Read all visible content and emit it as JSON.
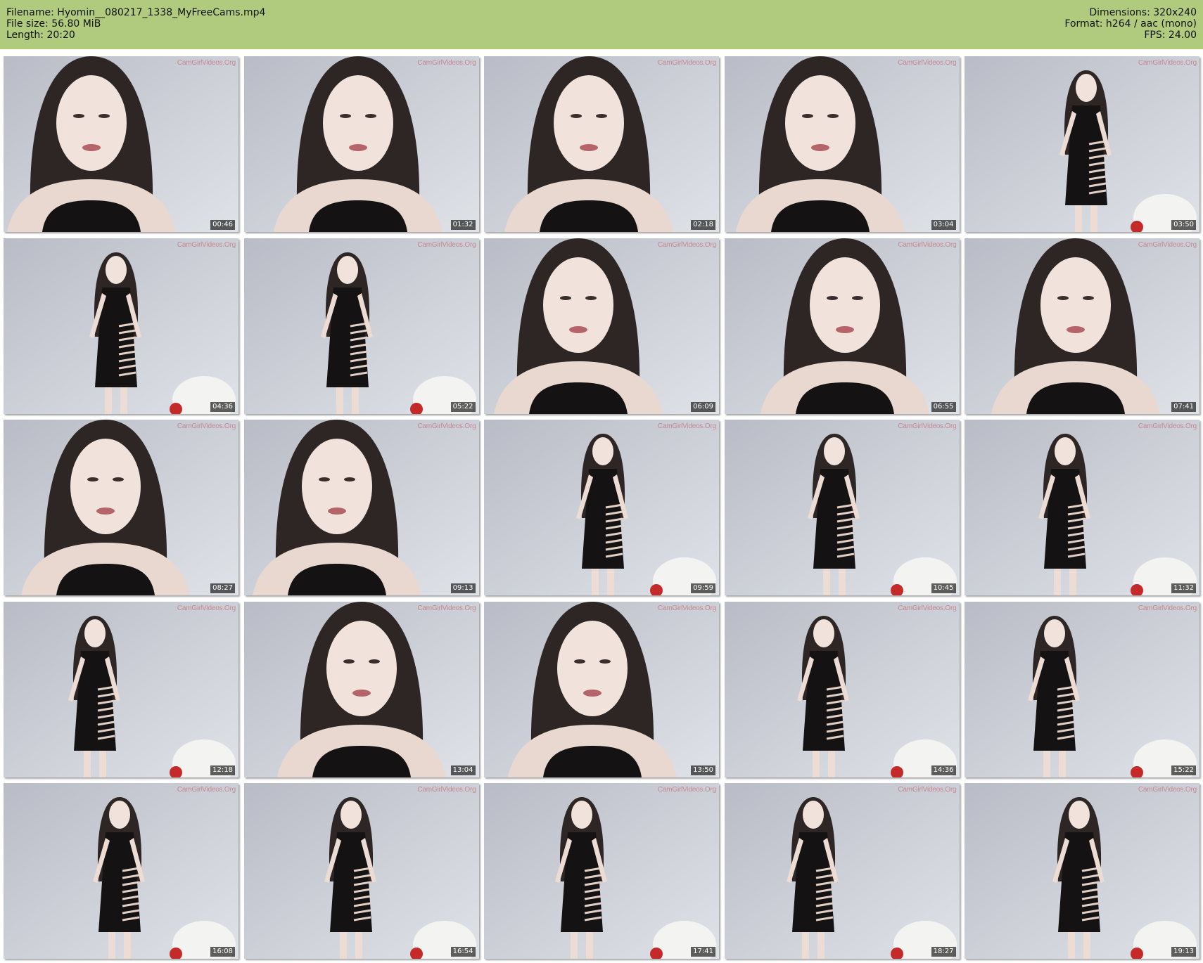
{
  "header": {
    "filename_label": "Filename: Hyomin__080217_1338_MyFreeCams.mp4",
    "filesize_label": "File size: 56.80 MiB",
    "length_label": "Length: 20:20",
    "dimensions_label": "Dimensions: 320x240",
    "format_label": "Format: h264 / aac (mono)",
    "fps_label": "FPS: 24.00",
    "background_color": "#b1cb7e"
  },
  "watermark": "CamGirlVideos.Org",
  "thumbnails": [
    {
      "timestamp": "00:46",
      "shot": "closeup"
    },
    {
      "timestamp": "01:32",
      "shot": "closeup"
    },
    {
      "timestamp": "02:18",
      "shot": "closeup"
    },
    {
      "timestamp": "03:04",
      "shot": "closeup"
    },
    {
      "timestamp": "03:50",
      "shot": "full-body"
    },
    {
      "timestamp": "04:36",
      "shot": "full-body"
    },
    {
      "timestamp": "05:22",
      "shot": "full-body"
    },
    {
      "timestamp": "06:09",
      "shot": "closeup"
    },
    {
      "timestamp": "06:55",
      "shot": "closeup"
    },
    {
      "timestamp": "07:41",
      "shot": "closeup"
    },
    {
      "timestamp": "08:27",
      "shot": "closeup"
    },
    {
      "timestamp": "09:13",
      "shot": "closeup"
    },
    {
      "timestamp": "09:59",
      "shot": "full-body"
    },
    {
      "timestamp": "10:45",
      "shot": "full-body"
    },
    {
      "timestamp": "11:32",
      "shot": "full-body"
    },
    {
      "timestamp": "12:18",
      "shot": "full-body"
    },
    {
      "timestamp": "13:04",
      "shot": "closeup"
    },
    {
      "timestamp": "13:50",
      "shot": "closeup"
    },
    {
      "timestamp": "14:36",
      "shot": "full-body"
    },
    {
      "timestamp": "15:22",
      "shot": "full-body"
    },
    {
      "timestamp": "16:08",
      "shot": "full-body"
    },
    {
      "timestamp": "16:54",
      "shot": "full-body"
    },
    {
      "timestamp": "17:41",
      "shot": "full-body"
    },
    {
      "timestamp": "18:27",
      "shot": "full-body"
    },
    {
      "timestamp": "19:13",
      "shot": "full-body"
    }
  ]
}
